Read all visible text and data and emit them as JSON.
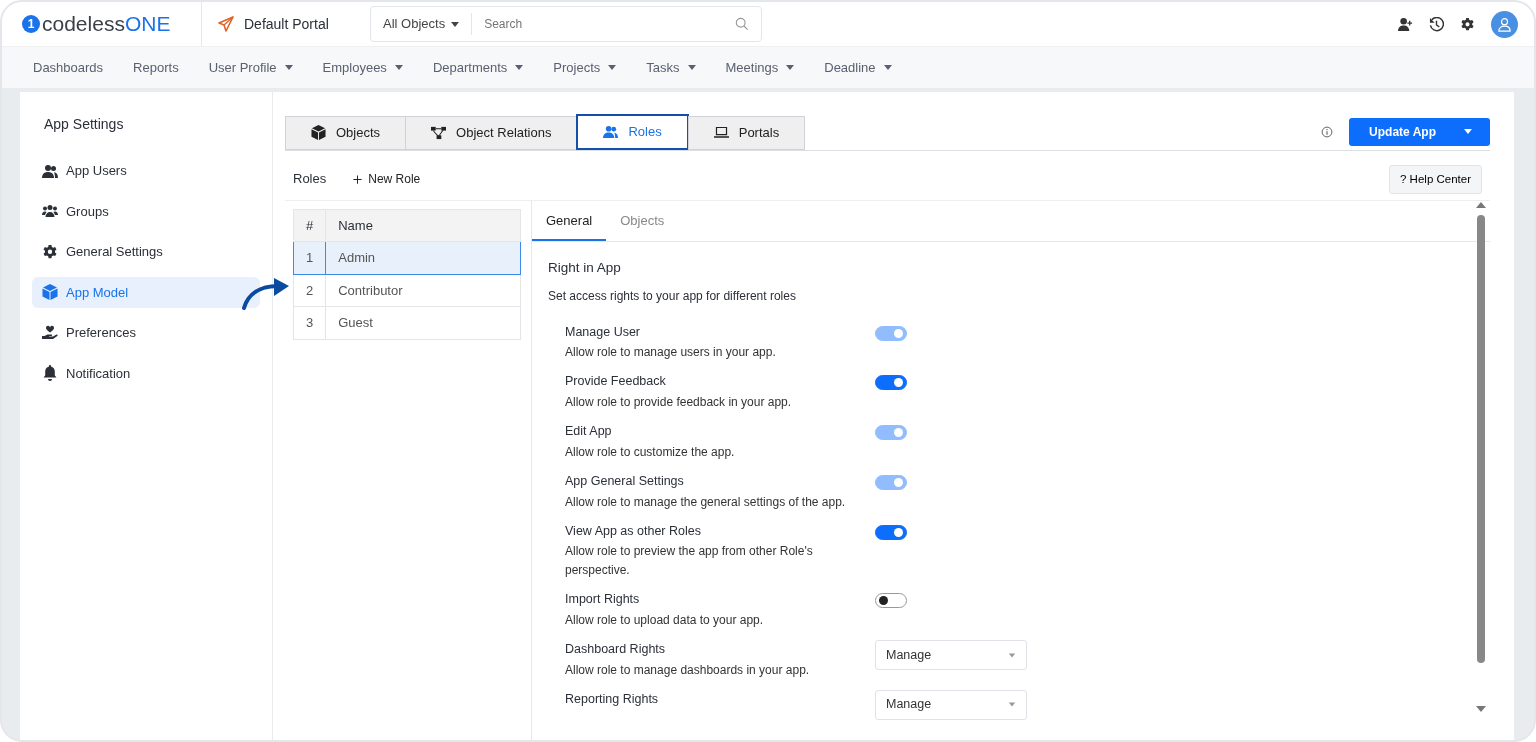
{
  "brand": {
    "logo_mark": "1",
    "name_part1": "codeless",
    "name_part2": "ONE"
  },
  "portal": {
    "name": "Default Portal"
  },
  "search": {
    "scope": "All Objects",
    "placeholder": "Search"
  },
  "nav": [
    {
      "label": "Dashboards",
      "dropdown": false
    },
    {
      "label": "Reports",
      "dropdown": false
    },
    {
      "label": "User Profile",
      "dropdown": true
    },
    {
      "label": "Employees",
      "dropdown": true
    },
    {
      "label": "Departments",
      "dropdown": true
    },
    {
      "label": "Projects",
      "dropdown": true
    },
    {
      "label": "Tasks",
      "dropdown": true
    },
    {
      "label": "Meetings",
      "dropdown": true
    },
    {
      "label": "Deadline",
      "dropdown": true
    }
  ],
  "sidebar": {
    "title": "App Settings",
    "items": [
      {
        "label": "App Users",
        "selected": false
      },
      {
        "label": "Groups",
        "selected": false
      },
      {
        "label": "General Settings",
        "selected": false
      },
      {
        "label": "App Model",
        "selected": true
      },
      {
        "label": "Preferences",
        "selected": false
      },
      {
        "label": "Notification",
        "selected": false
      }
    ]
  },
  "tabs": [
    {
      "label": "Objects",
      "selected": false
    },
    {
      "label": "Object Relations",
      "selected": false
    },
    {
      "label": "Roles",
      "selected": true
    },
    {
      "label": "Portals",
      "selected": false
    }
  ],
  "update_button": "Update App",
  "roles_label": "Roles",
  "new_role": "New Role",
  "help_center": "? Help Center",
  "roles_table": {
    "columns": [
      "#",
      "Name"
    ],
    "rows": [
      {
        "number": "1",
        "name": "Admin",
        "selected": true
      },
      {
        "number": "2",
        "name": "Contributor",
        "selected": false
      },
      {
        "number": "3",
        "name": "Guest",
        "selected": false
      }
    ]
  },
  "detail_tabs": [
    {
      "label": "General",
      "selected": true
    },
    {
      "label": "Objects",
      "selected": false
    }
  ],
  "section": {
    "title": "Right in App",
    "subtitle": "Set access rights to your app for different roles"
  },
  "rights": [
    {
      "kind": "toggle",
      "title": "Manage User",
      "description": "Allow role to manage users in your app.",
      "on": true,
      "disabled": true
    },
    {
      "kind": "toggle",
      "title": "Provide Feedback",
      "description": "Allow role to provide feedback in your app.",
      "on": true,
      "disabled": false
    },
    {
      "kind": "toggle",
      "title": "Edit App",
      "description": "Allow role to customize the app.",
      "on": true,
      "disabled": true
    },
    {
      "kind": "toggle",
      "title": "App General Settings",
      "description": "Allow role to manage the general settings of the app.",
      "on": true,
      "disabled": true
    },
    {
      "kind": "toggle",
      "title": "View App as other Roles",
      "description": "Allow role to preview the app from other Role's perspective.",
      "on": true,
      "disabled": false
    },
    {
      "kind": "toggle",
      "title": "Import Rights",
      "description": "Allow role to upload data to your app.",
      "on": false,
      "disabled": false
    },
    {
      "kind": "select",
      "title": "Dashboard Rights",
      "description": "Allow role to manage dashboards in your app.",
      "value": "Manage"
    },
    {
      "kind": "select",
      "title": "Reporting Rights",
      "value": "Manage"
    }
  ]
}
